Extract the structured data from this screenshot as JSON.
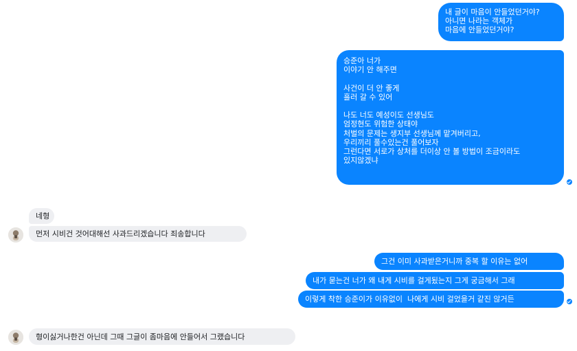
{
  "conversation": {
    "sent_group_1": [
      "내 글이 마음이 안들었던거야?\n아니면 나라는 객체가\n마음에 안들었던거야?",
      "승준아 너가\n이야기 안 해주면\n\n사건이 더 안 좋게\n흘러 갈 수 있어\n\n나도 너도 예성이도 선생님도\n엄정현도 위험한 상태야\n처벌의 문제는 생지부 선생님께 맡겨버리고,\n우리끼리 풀수있는건 풀어보자\n그런다면 서로가 상처를 더이상 안 볼 방법이 조금이라도\n있지않겠냐"
    ],
    "received_group_1": [
      "네형",
      "먼저 시비건 것어대해선 사과드리겠습니다 죄송합니다"
    ],
    "sent_group_2": [
      "그건 이미 사과받은거니까 중복 할 이유는 없어",
      "내가 묻는건 너가 왜 내게 시비를 걸게됬는지 그게 궁금해서 그래",
      "이렇게 착한 승준이가 이유없이  나에게 시비 걸었을거 같진 않거든"
    ],
    "received_group_2": [
      "형이싫거나한건 아닌데 그때 그글이 좀마음에 안들어서 그랬습니다"
    ]
  },
  "colors": {
    "sent_bubble": "#0a84ff",
    "received_bubble": "#eeeff2",
    "seen_check": "#0a84ff"
  },
  "icons": {
    "seen": "check-circle-icon",
    "contact": "avatar"
  }
}
